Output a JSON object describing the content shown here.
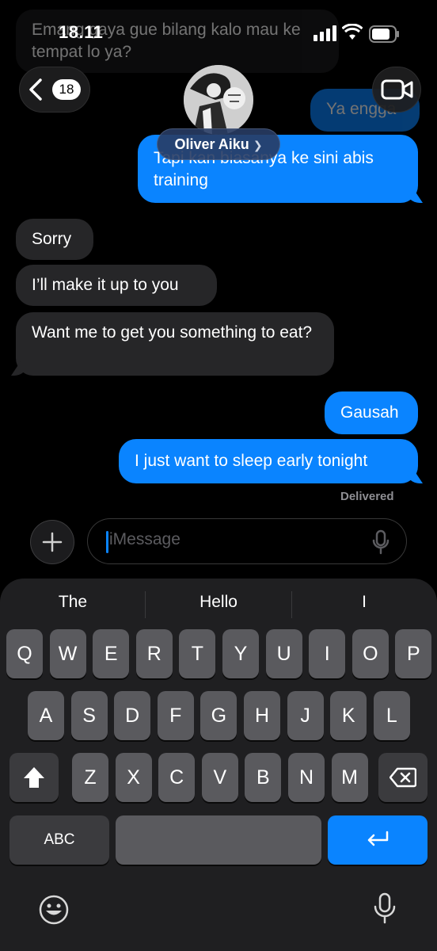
{
  "status": {
    "time": "18.11"
  },
  "header": {
    "back_count": "18",
    "contact_name": "Oliver Aiku"
  },
  "messages": {
    "top_faded_in": "Emang gaya gue bilang kalo mau ke tempat lo ya?",
    "out_ya_engga": "Ya engga",
    "out_tapi": "Tapi kan biasanya ke sini abis training",
    "in_sorry": "Sorry",
    "in_make_up": "I’ll make it up to you",
    "in_want": "Want me to get you something to eat?",
    "out_gausah": "Gausah",
    "out_sleep": "I just want to sleep early tonight",
    "delivered": "Delivered"
  },
  "input": {
    "placeholder": "iMessage"
  },
  "keyboard": {
    "suggestions": [
      "The",
      "Hello",
      "I"
    ],
    "row1": [
      "Q",
      "W",
      "E",
      "R",
      "T",
      "Y",
      "U",
      "I",
      "O",
      "P"
    ],
    "row2": [
      "A",
      "S",
      "D",
      "F",
      "G",
      "H",
      "J",
      "K",
      "L"
    ],
    "row3": [
      "Z",
      "X",
      "C",
      "V",
      "B",
      "N",
      "M"
    ],
    "abc_label": "ABC"
  }
}
